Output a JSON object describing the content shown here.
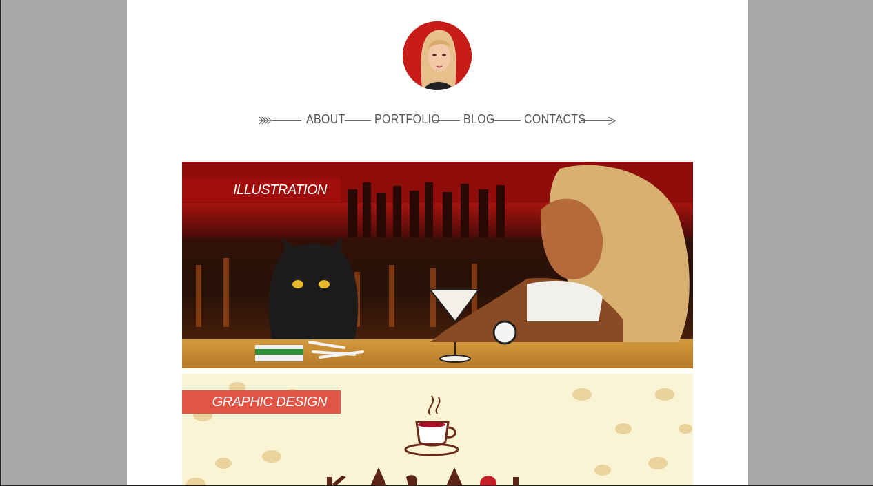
{
  "colors": {
    "background": "#a9a9a9",
    "page": "#ffffff",
    "nav_text": "#555555",
    "illustration_tag": "#a10d0a",
    "graphic_tag": "#e25546"
  },
  "profile": {
    "avatar_icon": "profile-photo"
  },
  "nav": {
    "items": [
      {
        "label": "ABOUT"
      },
      {
        "label": "PORTFOLIO"
      },
      {
        "label": "BLOG"
      },
      {
        "label": "CONTACTS"
      }
    ]
  },
  "portfolio": {
    "categories": [
      {
        "label": "ILLUSTRATION"
      },
      {
        "label": "GRAPHIC DESIGN"
      }
    ]
  }
}
